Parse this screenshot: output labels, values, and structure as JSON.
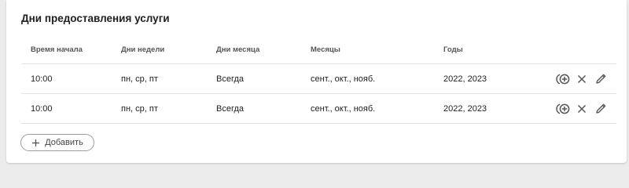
{
  "section": {
    "title": "Дни предоставления услуги"
  },
  "table": {
    "columns": [
      "Время начала",
      "Дни недели",
      "Дни месяца",
      "Месяцы",
      "Годы"
    ],
    "rows": [
      {
        "start_time": "10:00",
        "weekdays": "пн, ср, пт",
        "month_days": "Всегда",
        "months": "сент., окт., нояб.",
        "years": "2022, 2023"
      },
      {
        "start_time": "10:00",
        "weekdays": "пн, ср, пт",
        "month_days": "Всегда",
        "months": "сент., окт., нояб.",
        "years": "2022, 2023"
      }
    ],
    "row_actions": [
      "add-circle-icon",
      "close-icon",
      "edit-pencil-icon"
    ]
  },
  "add_button": {
    "label": "Добавить",
    "icon": "plus-icon"
  },
  "colors": {
    "icon": "#555555",
    "border": "#9e9e9e",
    "divider": "#e3e3e3"
  }
}
